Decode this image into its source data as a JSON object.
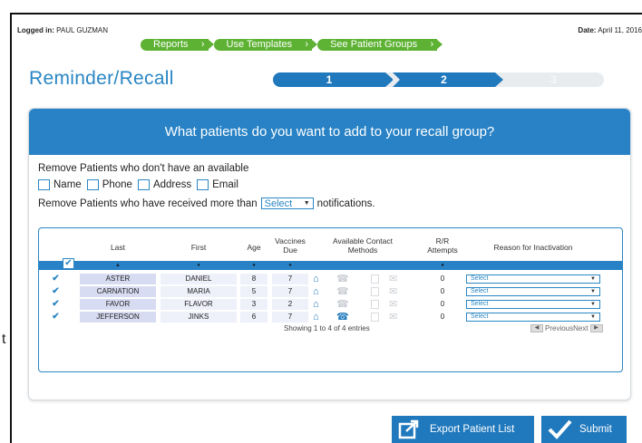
{
  "header": {
    "logged_in_label": "Logged in:",
    "user_name": "PAUL GUZMAN",
    "date_label": "Date:",
    "date_value": "April 11, 2016"
  },
  "nav": {
    "items": [
      {
        "label": "Reports"
      },
      {
        "label": "Use Templates"
      },
      {
        "label": "See Patient Groups"
      }
    ]
  },
  "page": {
    "title": "Reminder/Recall"
  },
  "steps": {
    "items": [
      "1",
      "2",
      "3"
    ],
    "current": 2
  },
  "panel": {
    "heading": "What patients do you want to add to your recall group?",
    "remove_available_label": "Remove Patients who don't have an available",
    "options": [
      {
        "label": "Name",
        "checked": false
      },
      {
        "label": "Phone",
        "checked": false
      },
      {
        "label": "Address",
        "checked": false
      },
      {
        "label": "Email",
        "checked": false
      }
    ],
    "remove_notif_prefix": "Remove Patients who have received more than",
    "notif_select_value": "Select",
    "remove_notif_suffix": "notifications."
  },
  "table": {
    "columns": {
      "last": "Last",
      "first": "First",
      "age": "Age",
      "vaccines_due_1": "Vaccines",
      "vaccines_due_2": "Due",
      "contact_1": "Available Contact",
      "contact_2": "Methods",
      "rr_1": "R/R",
      "rr_2": "Attempts",
      "reason": "Reason for Inactivation"
    },
    "rows": [
      {
        "last": "ASTER",
        "first": "DANIEL",
        "age": "8",
        "vaccines_due": "7",
        "phone_available": false,
        "rr_attempts": "0",
        "reason": "Select",
        "checked": true
      },
      {
        "last": "CARNATION",
        "first": "MARIA",
        "age": "5",
        "vaccines_due": "7",
        "phone_available": false,
        "rr_attempts": "0",
        "reason": "Select",
        "checked": true
      },
      {
        "last": "FAVOR",
        "first": "FLAVOR",
        "age": "3",
        "vaccines_due": "2",
        "phone_available": false,
        "rr_attempts": "0",
        "reason": "Select",
        "checked": true
      },
      {
        "last": "JEFFERSON",
        "first": "JINKS",
        "age": "6",
        "vaccines_due": "7",
        "phone_available": true,
        "rr_attempts": "0",
        "reason": "Select",
        "checked": true
      }
    ],
    "footer_text": "Showing 1 to 4 of 4 entries",
    "pager_previous": "Previous",
    "pager_next": "Next"
  },
  "actions": {
    "export_label": "Export Patient List",
    "submit_label": "Submit"
  },
  "stray_char": "t",
  "colors": {
    "accent_blue": "#2079bd",
    "nav_green": "#5db233",
    "row_highlight": "#d7dcf2"
  }
}
